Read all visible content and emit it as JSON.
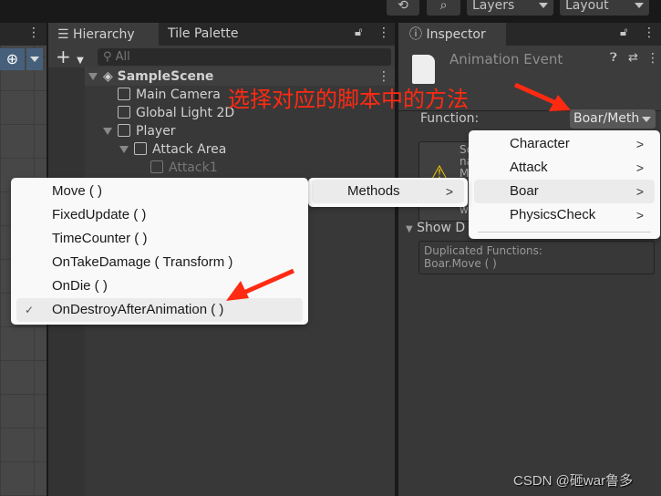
{
  "toolbar": {
    "layers": "Layers",
    "layout": "Layout",
    "history_icon": "history-icon",
    "search_icon": "search-icon"
  },
  "hierarchy": {
    "tabs": [
      "Hierarchy",
      "Tile Palette"
    ],
    "search_placeholder": "All",
    "scene": "SampleScene",
    "items": [
      "Main Camera",
      "Global Light 2D",
      "Player",
      "Attack Area",
      "Attack1"
    ]
  },
  "inspector": {
    "tab": "Inspector",
    "title": "Animation Event",
    "function_label": "Function:",
    "function_value": "Boar/Meth",
    "warning_fragments": [
      "Sc",
      "na",
      "M",
      "w"
    ],
    "show_label": "Show D",
    "duplicated_title": "Duplicated Functions:",
    "duplicated_item": "Boar.Move ( )"
  },
  "menus": {
    "components": [
      "Character",
      "Attack",
      "Boar",
      "PhysicsCheck"
    ],
    "methods_label": "Methods",
    "methods": [
      "Move ( )",
      "FixedUpdate ( )",
      "TimeCounter ( )",
      "OnTakeDamage ( Transform )",
      "OnDie ( )",
      "OnDestroyAfterAnimation ( )"
    ],
    "selected_method": "OnDestroyAfterAnimation ( )",
    "checkmark": "✓"
  },
  "annotation": {
    "text": "选择对应的脚本中的方法",
    "color": "#ff2a12"
  },
  "watermark": "CSDN @砸war鲁多"
}
